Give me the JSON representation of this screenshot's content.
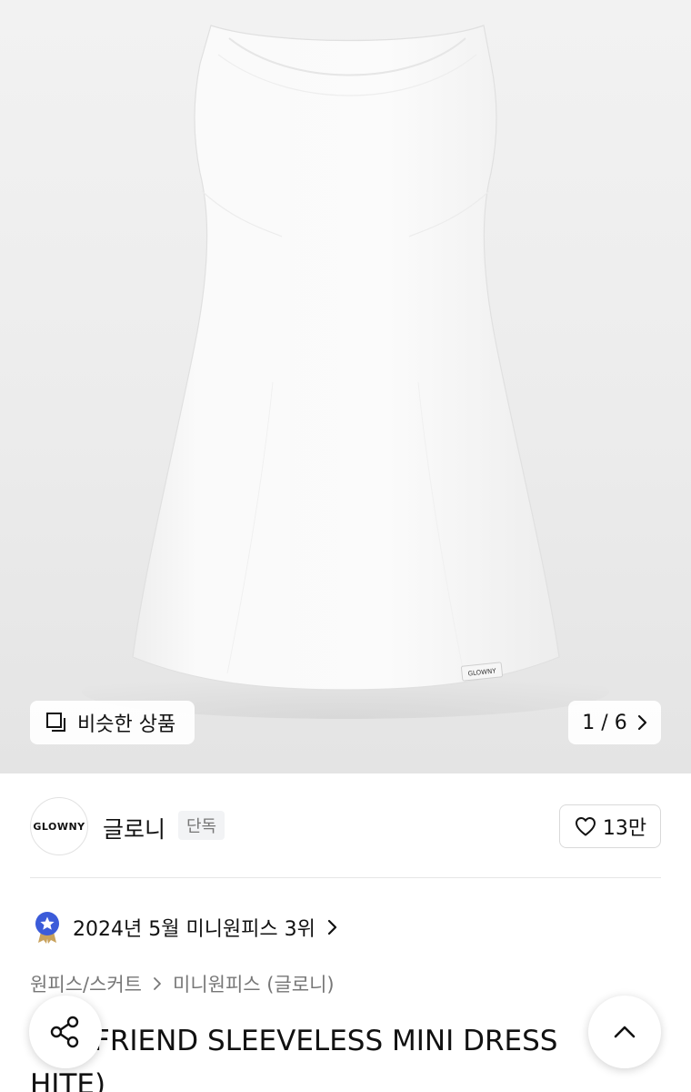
{
  "gallery": {
    "similar_label": "비슷한 상품",
    "counter": "1 / 6",
    "garment_tag": "GLOWNY"
  },
  "brand": {
    "logo_text": "GLOWNY",
    "name": "글로니",
    "badge": "단독",
    "likes": "13만"
  },
  "ranking": {
    "text": "2024년 5월 미니원피스 3위"
  },
  "breadcrumb": {
    "category": "원피스/스커트",
    "subcategory": "미니원피스 (글로니)"
  },
  "product": {
    "title": "(WHITE) FRIEND SLEEVELESS MINI DRESS (WHITE)",
    "title_visible": "FRIEND SLEEVELESS MINI DRESS\nHITE)"
  },
  "icons": {
    "similar": "similar-items-icon",
    "next": "chevron-right-icon",
    "like": "heart-outline-icon",
    "rank": "medal-star-icon",
    "share": "share-icon",
    "scroll_top": "chevron-up-icon"
  }
}
